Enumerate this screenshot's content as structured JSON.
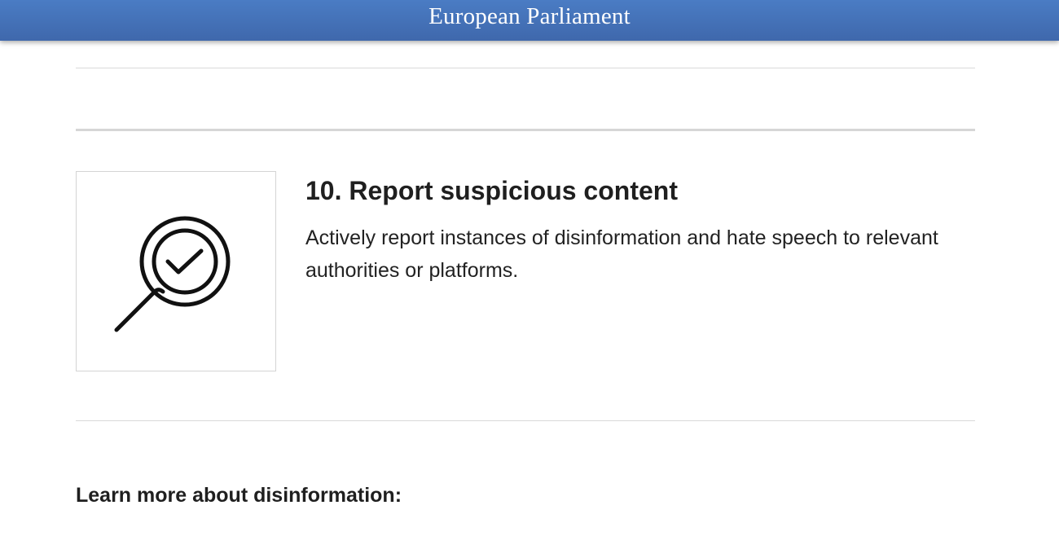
{
  "header": {
    "title": "European Parliament",
    "background_color": "#4272b8"
  },
  "tip": {
    "icon": "magnifier-check-icon",
    "title": "10. Report suspicious content",
    "description": "Actively report instances of disinformation and hate speech to relevant authorities or platforms."
  },
  "learn_more": {
    "heading": "Learn more about disinformation:"
  }
}
